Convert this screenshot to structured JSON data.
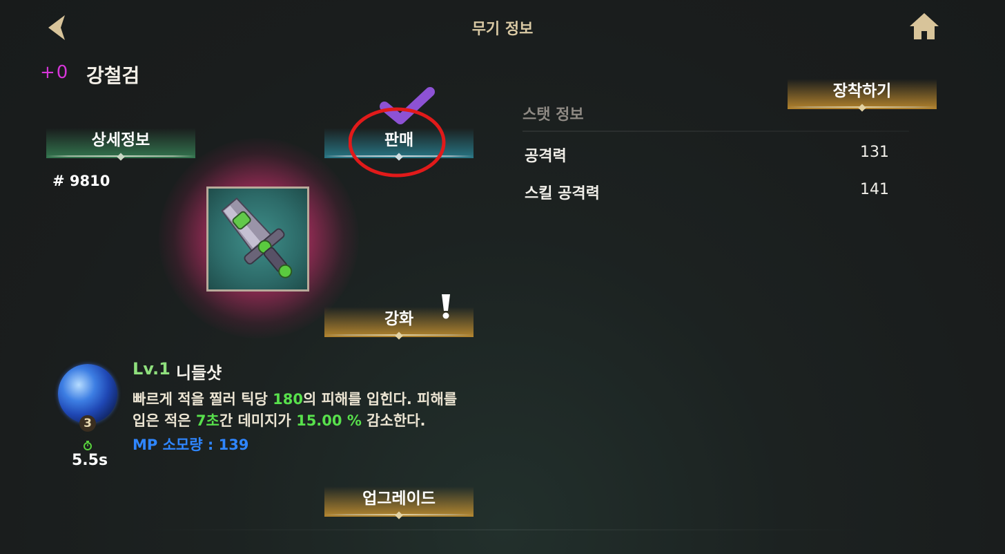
{
  "header": {
    "title": "무기 정보",
    "back_icon": "chevron-left-icon",
    "home_icon": "home-icon"
  },
  "weapon": {
    "enhance_level": "+0",
    "name": "강철검",
    "serial": "# 9810",
    "icon": "sword-icon"
  },
  "buttons": {
    "detail": "상세정보",
    "sell": "판매",
    "enhance": "강화",
    "equip": "장착하기",
    "upgrade": "업그레이드"
  },
  "stats": {
    "header": "스탯 정보",
    "rows": [
      {
        "label": "공격력",
        "value": "131"
      },
      {
        "label": "스킬 공격력",
        "value": "141"
      }
    ]
  },
  "skill": {
    "level": "Lv.1",
    "name": "니들샷",
    "badge": "3",
    "cooldown": "5.5s",
    "desc1_a": "빠르게 적을 찔러 틱당 ",
    "desc1_b": "180",
    "desc1_c": "의 피해를 입힌다. 피해를",
    "desc2_a": "입은 적은 ",
    "desc2_b": "7초",
    "desc2_c": "간 데미지가 ",
    "desc2_d": "15.00 %",
    "desc2_e": " 감소한다.",
    "mp": "MP 소모량 : 139"
  },
  "colors": {
    "enhance_level": "#d536d8",
    "highlight": "#58e04c",
    "mp": "#2f86ff",
    "title": "#d9c9a4"
  }
}
